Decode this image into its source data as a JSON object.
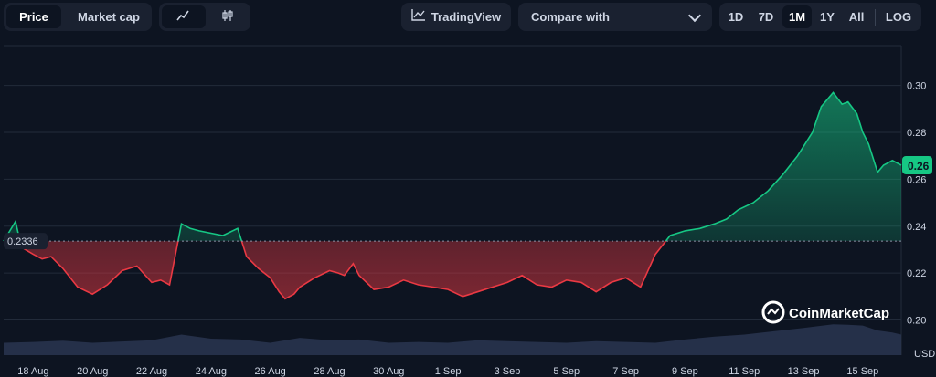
{
  "toolbar": {
    "tabs": [
      {
        "label": "Price",
        "active": true
      },
      {
        "label": "Market cap",
        "active": false
      }
    ],
    "chart_style": {
      "line_icon": "line-chart-icon",
      "candle_icon": "candlestick-icon"
    },
    "tradingview_label": "TradingView",
    "compare_label": "Compare with",
    "ranges": [
      {
        "label": "1D"
      },
      {
        "label": "7D"
      },
      {
        "label": "1M",
        "active": true
      },
      {
        "label": "1Y"
      },
      {
        "label": "All"
      }
    ],
    "log_label": "LOG"
  },
  "watermark": "CoinMarketCap",
  "currency_label": "USD",
  "chart_data": {
    "type": "area",
    "title": "",
    "y_ticks": [
      0.2,
      0.22,
      0.24,
      0.26,
      0.28,
      0.3
    ],
    "x_ticks": [
      "18 Aug",
      "20 Aug",
      "22 Aug",
      "24 Aug",
      "26 Aug",
      "28 Aug",
      "30 Aug",
      "1 Sep",
      "3 Sep",
      "5 Sep",
      "7 Sep",
      "9 Sep",
      "11 Sep",
      "13 Sep",
      "15 Sep"
    ],
    "ylim": [
      0.185,
      0.317
    ],
    "baseline": 0.2336,
    "baseline_label": "0.2336",
    "current_label": "0.26",
    "colors": {
      "up": "#16c784",
      "down": "#ea3943",
      "grid": "#222b3a",
      "badge": "#16c784"
    },
    "series": [
      {
        "name": "Price",
        "x": [
          0,
          0.4,
          0.6,
          1,
          1.3,
          1.6,
          2,
          2.5,
          3,
          3.5,
          4,
          4.5,
          5,
          5.3,
          5.6,
          6,
          6.3,
          6.6,
          7,
          7.4,
          7.9,
          8.2,
          8.6,
          9,
          9.3,
          9.5,
          9.8,
          10,
          10.5,
          11,
          11.3,
          11.5,
          11.8,
          12,
          12.5,
          13,
          13.5,
          14,
          14.5,
          15,
          15.5,
          16,
          16.5,
          17,
          17.5,
          18,
          18.5,
          19,
          19.5,
          20,
          20.5,
          21,
          21.5,
          22,
          22.5,
          23,
          23.5,
          24,
          24.4,
          24.8,
          25.3,
          25.8,
          26.3,
          26.8,
          27.3,
          27.6,
          28,
          28.3,
          28.5,
          28.8,
          29,
          29.2,
          29.5,
          29.7,
          30,
          30.3
        ],
        "y": [
          0.2336,
          0.242,
          0.231,
          0.228,
          0.226,
          0.227,
          0.222,
          0.214,
          0.211,
          0.215,
          0.221,
          0.223,
          0.216,
          0.217,
          0.215,
          0.241,
          0.239,
          0.238,
          0.237,
          0.236,
          0.239,
          0.227,
          0.222,
          0.218,
          0.212,
          0.209,
          0.211,
          0.214,
          0.218,
          0.221,
          0.22,
          0.219,
          0.224,
          0.219,
          0.213,
          0.214,
          0.217,
          0.215,
          0.214,
          0.213,
          0.21,
          0.212,
          0.214,
          0.216,
          0.219,
          0.215,
          0.214,
          0.217,
          0.216,
          0.212,
          0.216,
          0.218,
          0.214,
          0.228,
          0.236,
          0.238,
          0.239,
          0.241,
          0.243,
          0.247,
          0.25,
          0.255,
          0.262,
          0.27,
          0.28,
          0.291,
          0.297,
          0.292,
          0.293,
          0.288,
          0.28,
          0.275,
          0.263,
          0.266,
          0.268,
          0.266
        ]
      },
      {
        "name": "Volume",
        "x": [
          0,
          1,
          2,
          3,
          4,
          5,
          6,
          7,
          8,
          9,
          10,
          11,
          12,
          13,
          14,
          15,
          16,
          17,
          18,
          19,
          20,
          21,
          22,
          23,
          24,
          25,
          26,
          27,
          28,
          28.5,
          29,
          29.5,
          30,
          30.3
        ],
        "y": [
          0.3,
          0.32,
          0.35,
          0.3,
          0.33,
          0.36,
          0.5,
          0.4,
          0.38,
          0.3,
          0.42,
          0.36,
          0.38,
          0.3,
          0.32,
          0.3,
          0.36,
          0.34,
          0.32,
          0.3,
          0.34,
          0.32,
          0.3,
          0.38,
          0.45,
          0.5,
          0.58,
          0.66,
          0.75,
          0.74,
          0.72,
          0.6,
          0.55,
          0.5
        ]
      }
    ]
  }
}
